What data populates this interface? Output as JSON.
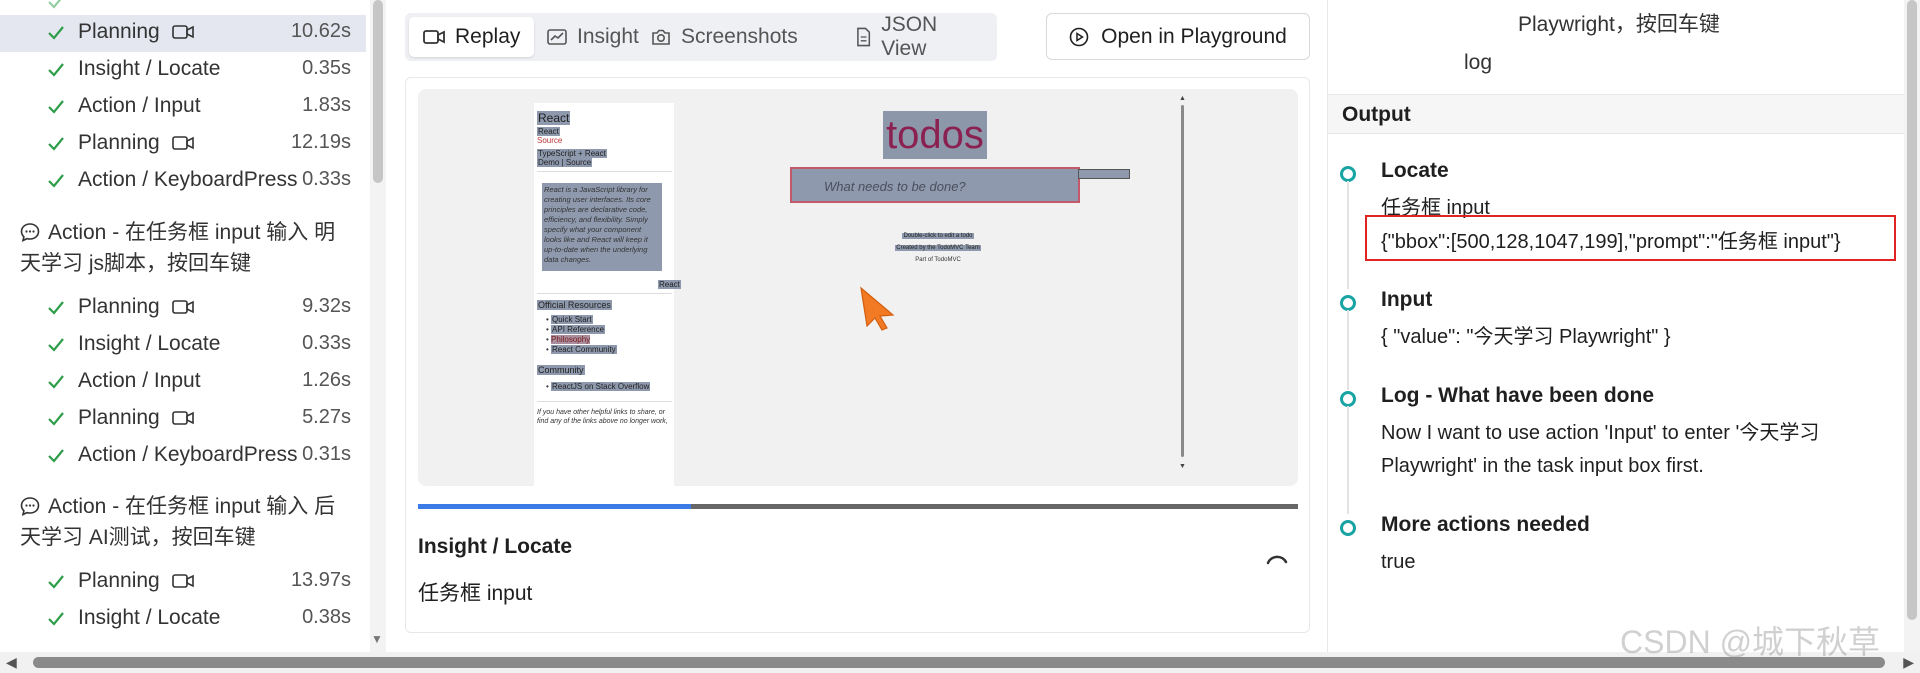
{
  "tasks": {
    "rows": [
      {
        "label": "Planning",
        "time": "10.62s",
        "video": true,
        "selected": true
      },
      {
        "label": "Insight / Locate",
        "time": "0.35s",
        "video": false
      },
      {
        "label": "Action / Input",
        "time": "1.83s",
        "video": false
      },
      {
        "label": "Planning",
        "time": "12.19s",
        "video": true
      },
      {
        "label": "Action / KeyboardPress",
        "time": "0.33s",
        "video": false
      },
      {
        "label": "Planning",
        "time": "9.32s",
        "video": true
      },
      {
        "label": "Insight / Locate",
        "time": "0.33s",
        "video": false
      },
      {
        "label": "Action / Input",
        "time": "1.26s",
        "video": false
      },
      {
        "label": "Planning",
        "time": "5.27s",
        "video": true
      },
      {
        "label": "Action / KeyboardPress",
        "time": "0.31s",
        "video": false
      },
      {
        "label": "Planning",
        "time": "13.97s",
        "video": true
      },
      {
        "label": "Insight / Locate",
        "time": "0.38s",
        "video": false
      }
    ],
    "groups": [
      {
        "line1": "Action - 在任务框 input 输入 明",
        "line2": "天学习 js脚本，按回车键"
      },
      {
        "line1": "Action - 在任务框 input 输入 后",
        "line2": "天学习 AI测试，按回车键"
      }
    ]
  },
  "tabs": [
    {
      "label": "Replay",
      "icon": "video-icon",
      "active": true
    },
    {
      "label": "Insight",
      "icon": "insight-icon",
      "active": false
    },
    {
      "label": "Screenshots",
      "icon": "camera-icon",
      "active": false
    },
    {
      "label": "JSON View",
      "icon": "file-icon",
      "active": false
    }
  ],
  "playground_button": "Open in Playground",
  "replay": {
    "screenshot": {
      "react_title": "React",
      "react_sub": "React",
      "source": "Source",
      "ts_react": "TypeScript + React",
      "demo_source": "Demo | Source",
      "quote": "React is a JavaScript library for creating user interfaces. Its core principles are declarative code, efficiency, and flexibility. Simply specify what your component looks like and React will keep it up-to-date when the underlying data changes.",
      "quote_link": "React",
      "official_resources": "Official Resources",
      "resources": [
        "Quick Start",
        "API Reference",
        "Philosophy",
        "React Community"
      ],
      "community": "Community",
      "community_items": [
        "ReactJS on Stack Overflow"
      ],
      "helpful_links": "If you have other helpful links to share, or find any of the links above no longer work,",
      "todos_title": "todos",
      "input_placeholder": "What needs to be done?",
      "footer_1": "Double-click to edit a todo",
      "footer_2": "Created by the TodoMVC Team",
      "footer_3": "Part of TodoMVC"
    },
    "progress": 0.31,
    "step_title": "Insight / Locate",
    "step_desc": "任务框 input"
  },
  "right": {
    "log_lines": [
      "Playwright，按回车键",
      "log"
    ],
    "output_header": "Output",
    "items": [
      {
        "title": "Locate",
        "text": "任务框 input"
      },
      {
        "title": "Input",
        "text": "{ \"value\": \"今天学习 Playwright\" }"
      },
      {
        "title": "Log - What have been done",
        "text": "Now I want to use action 'Input' to enter '今天学习 Playwright' in the task input box first."
      },
      {
        "title": "More actions needed",
        "text": "true"
      }
    ],
    "bbox_json": "{\"bbox\":[500,128,1047,199],\"prompt\":\"任务框 input\"}"
  },
  "watermark": "CSDN @城下秋草",
  "colors": {
    "accent": "#3b7be8",
    "timeline_dot": "#19a3a3",
    "highlight_box": "#e02424",
    "check": "#2e9d4a"
  }
}
